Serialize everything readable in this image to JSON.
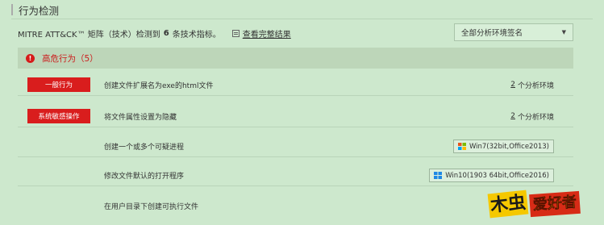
{
  "section": {
    "title": "行为检测"
  },
  "summary": {
    "prefix": "MITRE ATT&CK™ 矩阵（技术）检测到",
    "count": "6",
    "suffix": "条技术指标。",
    "link": "查看完整结果"
  },
  "env_select": {
    "value": "全部分析环境签名"
  },
  "danger": {
    "label": "高危行为（5）",
    "color": "#cc1b1b"
  },
  "rows": [
    {
      "tag": "一般行为",
      "desc": "创建文件扩展名为exe的html文件",
      "env_count": "2",
      "env_suffix": "个分析环境"
    },
    {
      "tag": "系统敏感操作",
      "desc": "将文件属性设置为隐藏",
      "env_count": "2",
      "env_suffix": "个分析环境"
    },
    {
      "tag": "",
      "desc": "创建一个或多个可疑进程",
      "env": "Win7(32bit,Office2013)",
      "env_icon": "windows7-icon"
    },
    {
      "tag": "",
      "desc": "修改文件默认的打开程序",
      "env": "Win10(1903 64bit,Office2016)",
      "env_icon": "windows10-icon"
    },
    {
      "tag": "",
      "desc": "在用户目录下创建可执行文件"
    }
  ],
  "watermark": {
    "part1": "木虫",
    "part2": "爱好者"
  }
}
